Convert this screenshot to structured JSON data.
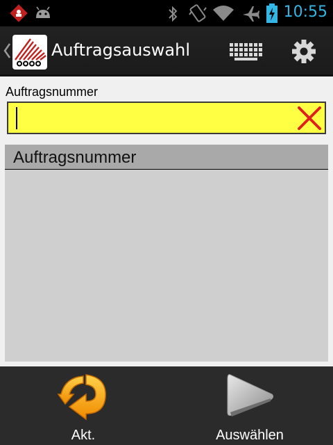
{
  "status_bar": {
    "time": "10:55",
    "icons": [
      "notification-app-icon",
      "android-debug-icon",
      "bluetooth-icon",
      "vibrate-icon",
      "wifi-icon",
      "airplane-icon",
      "battery-charging-icon"
    ],
    "accent_color": "#33b5e5"
  },
  "action_bar": {
    "title": "Auftragsauswahl",
    "icons": [
      "up-chevron-icon",
      "app-logo",
      "keyboard-icon",
      "gear-icon"
    ]
  },
  "form": {
    "order_label": "Auftragsnummer",
    "order_value": "",
    "input_bg": "#ffff44"
  },
  "list": {
    "header": "Auftragsnummer",
    "items": []
  },
  "bottom_bar": {
    "refresh_label": "Akt.",
    "select_label": "Auswählen"
  }
}
